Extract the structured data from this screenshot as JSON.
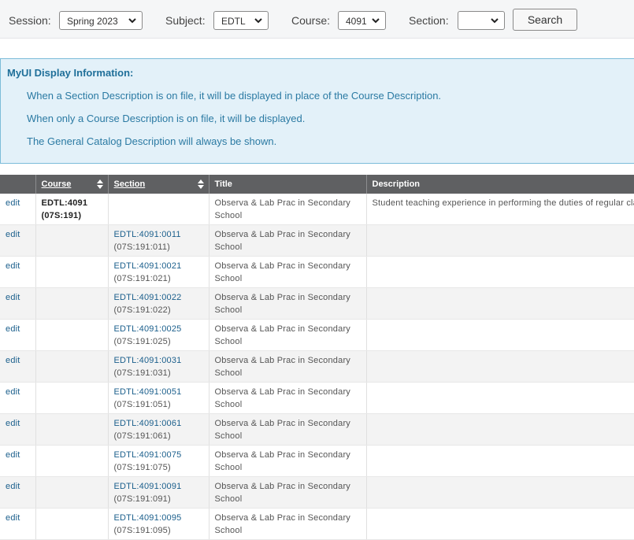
{
  "filters": {
    "session": {
      "label": "Session:",
      "value": "Spring 2023"
    },
    "subject": {
      "label": "Subject:",
      "value": "EDTL"
    },
    "course": {
      "label": "Course:",
      "value": "4091"
    },
    "section": {
      "label": "Section:",
      "value": ""
    },
    "search_label": "Search"
  },
  "info": {
    "title": "MyUI Display Information:",
    "lines": [
      "When a Section Description is on file, it will be displayed in place of the Course Description.",
      "When only a Course Description is on file, it will be displayed.",
      "The General Catalog Description will always be shown."
    ]
  },
  "table": {
    "headers": {
      "edit": "",
      "course": "Course",
      "section": "Section",
      "title": "Title",
      "description": "Description"
    },
    "course_row": {
      "edit": "edit",
      "course_code": "EDTL:4091",
      "course_alt": "(07S:191)",
      "title_line1": "Observa & Lab Prac in Secondary",
      "title_line2": "School",
      "description": "Student teaching experience in performing the duties of regular class"
    },
    "rows": [
      {
        "edit": "edit",
        "section": "EDTL:4091:0011",
        "section_alt": "(07S:191:011)",
        "title_line1": "Observa & Lab Prac in Secondary",
        "title_line2": "School"
      },
      {
        "edit": "edit",
        "section": "EDTL:4091:0021",
        "section_alt": "(07S:191:021)",
        "title_line1": "Observa & Lab Prac in Secondary",
        "title_line2": "School"
      },
      {
        "edit": "edit",
        "section": "EDTL:4091:0022",
        "section_alt": "(07S:191:022)",
        "title_line1": "Observa & Lab Prac in Secondary",
        "title_line2": "School"
      },
      {
        "edit": "edit",
        "section": "EDTL:4091:0025",
        "section_alt": "(07S:191:025)",
        "title_line1": "Observa & Lab Prac in Secondary",
        "title_line2": "School"
      },
      {
        "edit": "edit",
        "section": "EDTL:4091:0031",
        "section_alt": "(07S:191:031)",
        "title_line1": "Observa & Lab Prac in Secondary",
        "title_line2": "School"
      },
      {
        "edit": "edit",
        "section": "EDTL:4091:0051",
        "section_alt": "(07S:191:051)",
        "title_line1": "Observa & Lab Prac in Secondary",
        "title_line2": "School"
      },
      {
        "edit": "edit",
        "section": "EDTL:4091:0061",
        "section_alt": "(07S:191:061)",
        "title_line1": "Observa & Lab Prac in Secondary",
        "title_line2": "School"
      },
      {
        "edit": "edit",
        "section": "EDTL:4091:0075",
        "section_alt": "(07S:191:075)",
        "title_line1": "Observa & Lab Prac in Secondary",
        "title_line2": "School"
      },
      {
        "edit": "edit",
        "section": "EDTL:4091:0091",
        "section_alt": "(07S:191:091)",
        "title_line1": "Observa & Lab Prac in Secondary",
        "title_line2": "School"
      },
      {
        "edit": "edit",
        "section": "EDTL:4091:0095",
        "section_alt": "(07S:191:095)",
        "title_line1": "Observa & Lab Prac in Secondary",
        "title_line2": "School"
      }
    ]
  },
  "icons": {
    "select_arrow": "chevron-down-icon",
    "sort": "sort-icon"
  }
}
